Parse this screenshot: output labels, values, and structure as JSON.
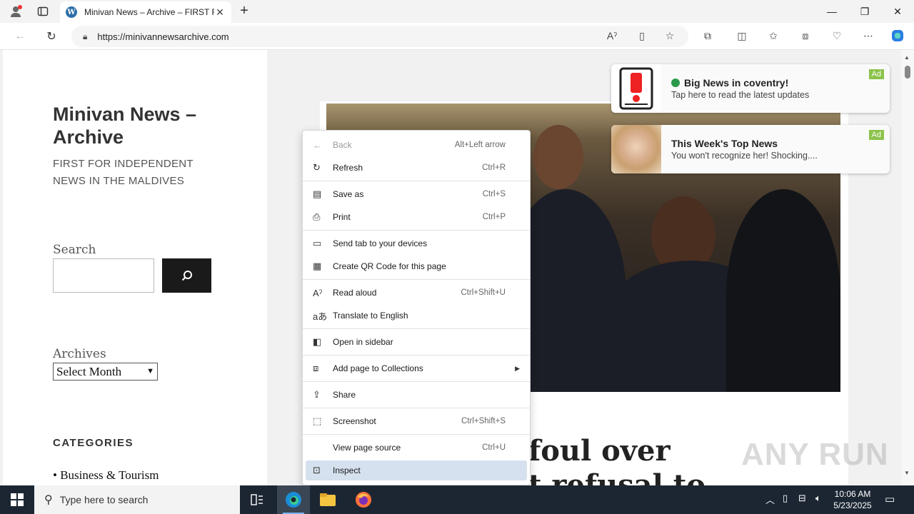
{
  "browser": {
    "tab_title": "Minivan News – Archive – FIRST F",
    "url": "https://minivannewsarchive.com"
  },
  "sidebar": {
    "site_title": "Minivan News – Archive",
    "site_description": "FIRST FOR INDEPENDENT NEWS IN THE MALDIVES",
    "search_label": "Search",
    "archives_label": "Archives",
    "archives_select": "Select Month",
    "categories_label": "CATEGORIES",
    "category_item": "Business & Tourism"
  },
  "article": {
    "headline_fragment": "foul over",
    "headline_fragment2": "t refusal to"
  },
  "ads": [
    {
      "title": "Big News in coventry!",
      "body": "Tap here to read the latest updates",
      "tag": "Ad"
    },
    {
      "title": "This Week's Top News",
      "body": "You won't recognize her! Shocking....",
      "tag": "Ad"
    }
  ],
  "context_menu": {
    "items": [
      {
        "label": "Back",
        "shortcut": "Alt+Left arrow",
        "icon": "back-arrow-icon",
        "disabled": true
      },
      {
        "label": "Refresh",
        "shortcut": "Ctrl+R",
        "icon": "refresh-icon"
      },
      {
        "label": "Save as",
        "shortcut": "Ctrl+S",
        "icon": "save-icon"
      },
      {
        "label": "Print",
        "shortcut": "Ctrl+P",
        "icon": "print-icon"
      },
      {
        "label": "Send tab to your devices",
        "shortcut": "",
        "icon": "devices-icon"
      },
      {
        "label": "Create QR Code for this page",
        "shortcut": "",
        "icon": "qr-code-icon"
      },
      {
        "label": "Read aloud",
        "shortcut": "Ctrl+Shift+U",
        "icon": "read-aloud-icon"
      },
      {
        "label": "Translate to English",
        "shortcut": "",
        "icon": "translate-icon"
      },
      {
        "label": "Open in sidebar",
        "shortcut": "",
        "icon": "sidebar-icon"
      },
      {
        "label": "Add page to Collections",
        "shortcut": "",
        "icon": "collections-icon"
      },
      {
        "label": "Share",
        "shortcut": "",
        "icon": "share-icon"
      },
      {
        "label": "Screenshot",
        "shortcut": "Ctrl+Shift+S",
        "icon": "screenshot-icon"
      },
      {
        "label": "View page source",
        "shortcut": "Ctrl+U",
        "icon": ""
      },
      {
        "label": "Inspect",
        "shortcut": "",
        "icon": "inspect-icon"
      }
    ]
  },
  "taskbar": {
    "search_placeholder": "Type here to search",
    "time": "10:06 AM",
    "date": "5/23/2025"
  },
  "watermark": "ANY RUN"
}
